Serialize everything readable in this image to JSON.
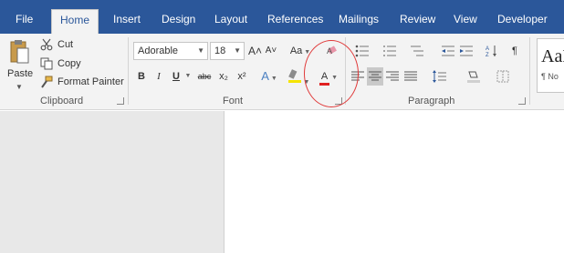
{
  "tabs": [
    "File",
    "Home",
    "Insert",
    "Design",
    "Layout",
    "References",
    "Mailings",
    "Review",
    "View",
    "Developer"
  ],
  "clipboard": {
    "paste_label": "Paste",
    "cut_label": "Cut",
    "copy_label": "Copy",
    "format_painter_label": "Format Painter",
    "group_label": "Clipboard"
  },
  "font": {
    "font_name": "Adorable",
    "font_size": "18",
    "bold_label": "B",
    "italic_label": "I",
    "underline_label": "U",
    "strikethrough_label": "abc",
    "subscript_label": "x₂",
    "superscript_label": "x²",
    "grow_label": "A˄",
    "shrink_label": "A˅",
    "change_case_label": "Aa",
    "text_effects_label": "A",
    "font_color_label": "A",
    "group_label": "Font"
  },
  "paragraph": {
    "group_label": "Paragraph"
  },
  "styles": {
    "sample_text": "AaB",
    "style_name": "¶ No"
  },
  "colors": {
    "title_bar": "#2b579a",
    "ribbon_bg": "#f3f3f3",
    "font_color_accent": "#e02020",
    "highlight_accent": "#f5e400",
    "annotation_circle": "#e03a3a"
  }
}
